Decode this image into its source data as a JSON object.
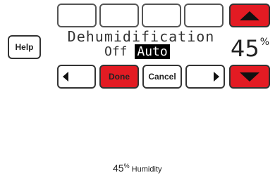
{
  "top_row": {
    "empty_buttons": [
      "",
      "",
      "",
      ""
    ]
  },
  "help": {
    "label": "Help"
  },
  "setting": {
    "title": "Dehumidification",
    "option_off": "Off",
    "option_auto": "Auto",
    "selected": "Auto"
  },
  "humidity_setpoint": {
    "value": "45",
    "unit": "%"
  },
  "controls": {
    "done_label": "Done",
    "cancel_label": "Cancel"
  },
  "status_bar": {
    "humidity_value": "45",
    "humidity_unit": "%",
    "humidity_label": "Humidity"
  },
  "colors": {
    "accent_red": "#e31b23",
    "selected_bg": "#000000"
  },
  "icons": {
    "up": "triangle-up-icon",
    "down": "triangle-down-icon",
    "left": "triangle-left-icon",
    "right": "triangle-right-icon"
  }
}
